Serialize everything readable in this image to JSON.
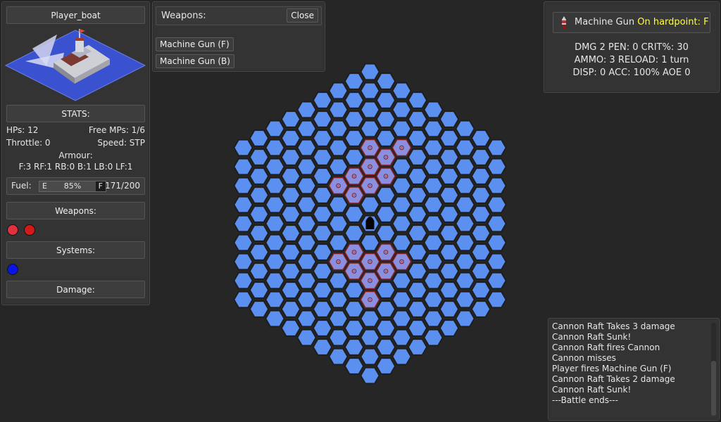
{
  "ship_panel": {
    "name": "Player_boat",
    "stats_header": "STATS:",
    "hps": "HPs: 12",
    "free_mps": "Free MPs: 1/6",
    "throttle": "Throttle: 0",
    "speed": "Speed: STP",
    "armour_label": "Armour:",
    "armour_values": "F:3 RF:1 RB:0 B:1 LB:0 LF:1",
    "fuel_label": "Fuel:",
    "fuel_empty": "E",
    "fuel_percent_text": "85%",
    "fuel_full": "F",
    "fuel_level": 0.85,
    "fuel_amount": "171/200",
    "weapons_header": "Weapons:",
    "systems_header": "Systems:",
    "damage_header": "Damage:",
    "weapon_dot_colors": [
      "#e0323c",
      "#d11a1a"
    ],
    "system_dot_colors": [
      "#0a14e6"
    ]
  },
  "weapons_panel": {
    "title": "Weapons:",
    "close_label": "Close",
    "items": [
      "Machine Gun (F)",
      "Machine Gun (B)"
    ]
  },
  "info_panel": {
    "weapon_name": "Machine Gun",
    "hardpoint": "On hardpoint: F",
    "line1": "DMG 2 PEN: 0 CRIT%: 30",
    "line2": "AMMO: 3 RELOAD: 1 turn",
    "line3": "DISP: 0 ACC: 100% AOE 0",
    "icon": "bullet-icon",
    "hardpoint_color": "#ffff33"
  },
  "log": {
    "lines": [
      "Cannon Raft Takes 3 damage",
      "Cannon Raft Sunk!",
      "Cannon Raft fires Cannon",
      "Cannon misses",
      "Player fires Machine Gun (F)",
      "Cannon Raft Takes 2 damage",
      "Cannon Raft Sunk!",
      "---Battle ends---"
    ]
  },
  "colors": {
    "water_hex": "#5b8ff0",
    "hex_border": "#1e1e1e",
    "target_hex": "#8b8fe0",
    "target_border": "#8a1e1e",
    "background": "#262626"
  }
}
